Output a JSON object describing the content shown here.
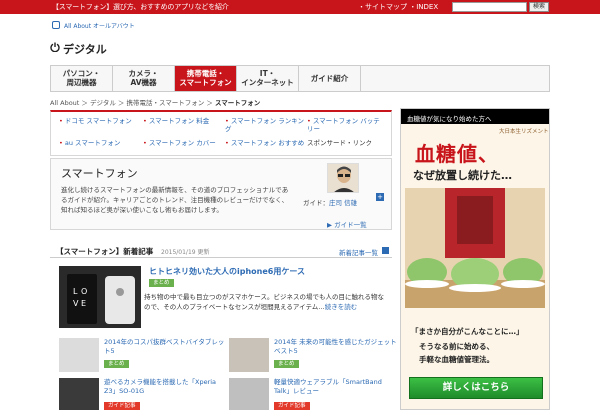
{
  "topbar": {
    "tagline": "【スマートフォン】選び方、おすすめのアプリなどを紹介",
    "links": "・サイトマップ ・INDEX",
    "search_label": "検索"
  },
  "brand": {
    "allabout": "All About オールアバウト",
    "section": "デジタル"
  },
  "nav": {
    "tabs": [
      {
        "line1": "パソコン・",
        "line2": "周辺機器"
      },
      {
        "line1": "カメラ・",
        "line2": "AV機器"
      },
      {
        "line1": "携帯電話・",
        "line2": "スマートフォン"
      },
      {
        "line1": "IT・",
        "line2": "インターネット"
      },
      {
        "line1": "ガイド紹介",
        "line2": ""
      }
    ]
  },
  "breadcrumb": {
    "path": "All About ＞ デジタル ＞ 携帯電話・スマートフォン ＞",
    "current": "スマートフォン"
  },
  "sublinks": {
    "docomo": "ドコモ スマートフォン",
    "ryokin": "スマートフォン 料金",
    "ranking_1": "スマートフォン ランキン",
    "ranking_2": "グ",
    "battery_1": "スマートフォン バッテ",
    "battery_2": "リー",
    "au": "au スマートフォン",
    "cover": "スマートフォン カバー",
    "osusume": "スマートフォン おすすめ",
    "spotsearch": "スポンサード・リンク"
  },
  "feature": {
    "title": "スマートフォン",
    "desc": "進化し続けるスマートフォンの最新情報を、その道のプロフェッショナルであるガイドが紹介。キャリアごとのトレンド、注目機種のレビューだけでなく、知れば知るほど奥が深い使いこなし術もお届けします。",
    "guide_prefix": "ガイド：",
    "guide_name": "庄司 信雄",
    "guide_list": "▶ ガイド一覧"
  },
  "news": {
    "title": "【スマートフォン】新着記事",
    "date": "2015/01/19 更新",
    "more": "新着記事一覧",
    "main_title": "ヒトヒネリ効いた大人のiphone6用ケース",
    "main_badge": "まとめ",
    "main_text": "持ち物の中で最も目立つのがスマホケース。ビジネスの場でも人の目に触れる物なので、その人のプライベートなセンスが垣間見えるアイテム…",
    "main_more": "続きを読む",
    "articles": [
      {
        "title": "2014年のコスパ抜群ベストバイタブレット5",
        "badge": "まとめ"
      },
      {
        "title": "2014年 未来の可能性を感じたガジェット ベスト5",
        "badge": "まとめ"
      },
      {
        "title": "遊べるカメラ機能を搭載した「Xperia Z3」SO-01G",
        "badge": "ガイド記事"
      },
      {
        "title": "軽量快適ウェアラブル「SmartBand Talk」レビュー",
        "badge": "ガイド記事"
      }
    ]
  },
  "ad": {
    "top": "血糖値が気になり始めた方へ",
    "brand": "大日本生リズメント",
    "headline": "血糖値、",
    "sub": "なぜ放置し続けた…",
    "q": "「まさか自分がこんなことに…」",
    "line2": "そうなる前に始める、",
    "line3": "手軽な血糖値管理法。",
    "cta": "詳しくはこちら"
  },
  "colors": {
    "accent": "#c8151b",
    "link": "#2c6ab3",
    "badge_green": "#6ab04c",
    "badge_red": "#e2392b",
    "cta_green": "#2ea836"
  }
}
